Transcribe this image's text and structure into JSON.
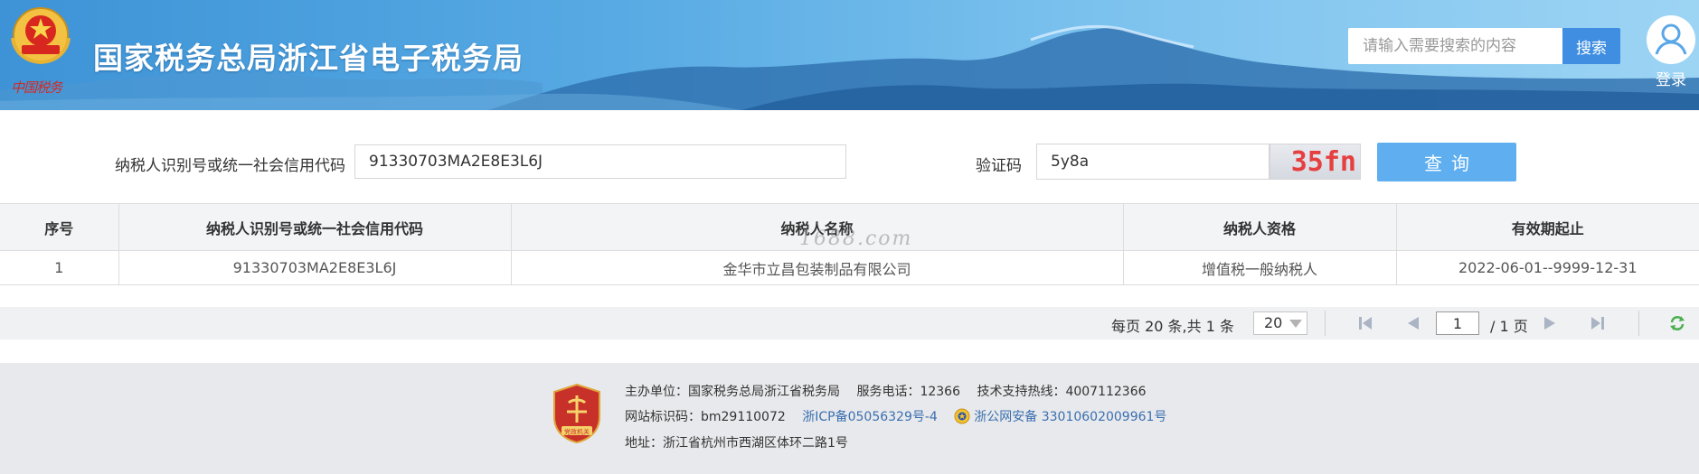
{
  "header": {
    "seal_text": "中国税务",
    "title": "国家税务总局浙江省电子税务局",
    "search_placeholder": "请输入需要搜索的内容",
    "search_button": "搜索",
    "login_label": "登录"
  },
  "form": {
    "tax_id_label": "纳税人识别号或统一社会信用代码",
    "tax_id_value": "91330703MA2E8E3L6J",
    "captcha_label": "验证码",
    "captcha_value": "5y8a",
    "captcha_image_text": "35fn",
    "query_button": "查询"
  },
  "table": {
    "columns": [
      "序号",
      "纳税人识别号或统一社会信用代码",
      "纳税人名称",
      "纳税人资格",
      "有效期起止"
    ],
    "rows": [
      [
        "1",
        "91330703MA2E8E3L6J",
        "金华市立昌包装制品有限公司",
        "增值税一般纳税人",
        "2022-06-01--9999-12-31"
      ]
    ],
    "watermark": "1688.com"
  },
  "pager": {
    "summary": "每页 20 条,共 1 条",
    "page_size": "20",
    "current_page": "1",
    "total_pages": "/ 1 页"
  },
  "footer": {
    "host": "主办单位：国家税务总局浙江省税务局",
    "service_phone": "服务电话：12366",
    "tech_hotline": "技术支持热线：4007112366",
    "site_code": "网站标识码：bm29110072",
    "icp": "浙ICP备05056329号-4",
    "police_record": "浙公网安备 33010602009961号",
    "address": "地址：浙江省杭州市西湖区体环二路1号",
    "badge_text": "党政机关"
  },
  "colors": {
    "header_blue": "#3d93d6",
    "search_button": "#3f8ee2",
    "query_button": "#5eaef0",
    "captcha_text": "#e53f3f",
    "link": "#3a6fb0"
  },
  "icons": [
    "tax-emblem-icon",
    "avatar-icon",
    "first-page-icon",
    "prev-page-icon",
    "next-page-icon",
    "last-page-icon",
    "refresh-icon",
    "dangzheng-badge-icon",
    "police-badge-icon"
  ]
}
